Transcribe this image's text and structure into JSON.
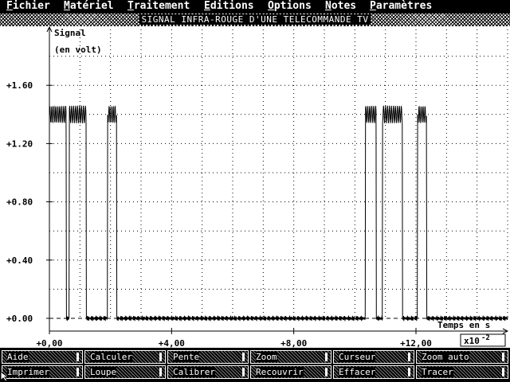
{
  "menu": {
    "items": [
      {
        "first": "F",
        "rest": "ichier"
      },
      {
        "first": "M",
        "rest": "atériel"
      },
      {
        "first": "T",
        "rest": "raitement"
      },
      {
        "first": "E",
        "rest": "ditions"
      },
      {
        "first": "O",
        "rest": "ptions"
      },
      {
        "first": "N",
        "rest": "otes"
      },
      {
        "first": "P",
        "rest": "aramètres"
      }
    ]
  },
  "window": {
    "title": "SIGNAL INFRA-ROUGE D'UNE TELECOMMANDE TV"
  },
  "chart_data": {
    "type": "line",
    "title": "SIGNAL INFRA-ROUGE D'UNE TELECOMMANDE TV",
    "ylabel_line1": "Signal",
    "ylabel_line2": "(en volt)",
    "xlabel": "Temps en s",
    "x_multiplier": "x10",
    "x_multiplier_exp": "-2",
    "xlim": [
      0,
      15
    ],
    "ylim": [
      -0.05,
      1.9
    ],
    "grid": true,
    "y_ticks": [
      "+1.60",
      "+1.20",
      "+0.80",
      "+0.40",
      "+0.00"
    ],
    "x_ticks": [
      "+0,00",
      "+4,00",
      "+8,00",
      "+12,00"
    ],
    "series": [
      {
        "high_level": 1.4,
        "low_level": 0.0,
        "pulses": [
          [
            0.0,
            0.55
          ],
          [
            0.65,
            1.2
          ],
          [
            1.9,
            2.2
          ],
          [
            10.35,
            10.7
          ],
          [
            10.9,
            11.55
          ],
          [
            12.05,
            12.35
          ]
        ]
      }
    ]
  },
  "buttons": [
    {
      "label": "Aide"
    },
    {
      "label": "Calculer"
    },
    {
      "label": "Pente"
    },
    {
      "label": "Zoom"
    },
    {
      "label": "Curseur"
    },
    {
      "label": "Zoom auto"
    },
    {
      "label": "Imprimer"
    },
    {
      "label": "Loupe"
    },
    {
      "label": "Calibrer"
    },
    {
      "label": "Recouvrir"
    },
    {
      "label": "Effacer"
    },
    {
      "label": "Tracer"
    }
  ],
  "colors": {
    "background": "#ffffff",
    "foreground": "#000000"
  }
}
